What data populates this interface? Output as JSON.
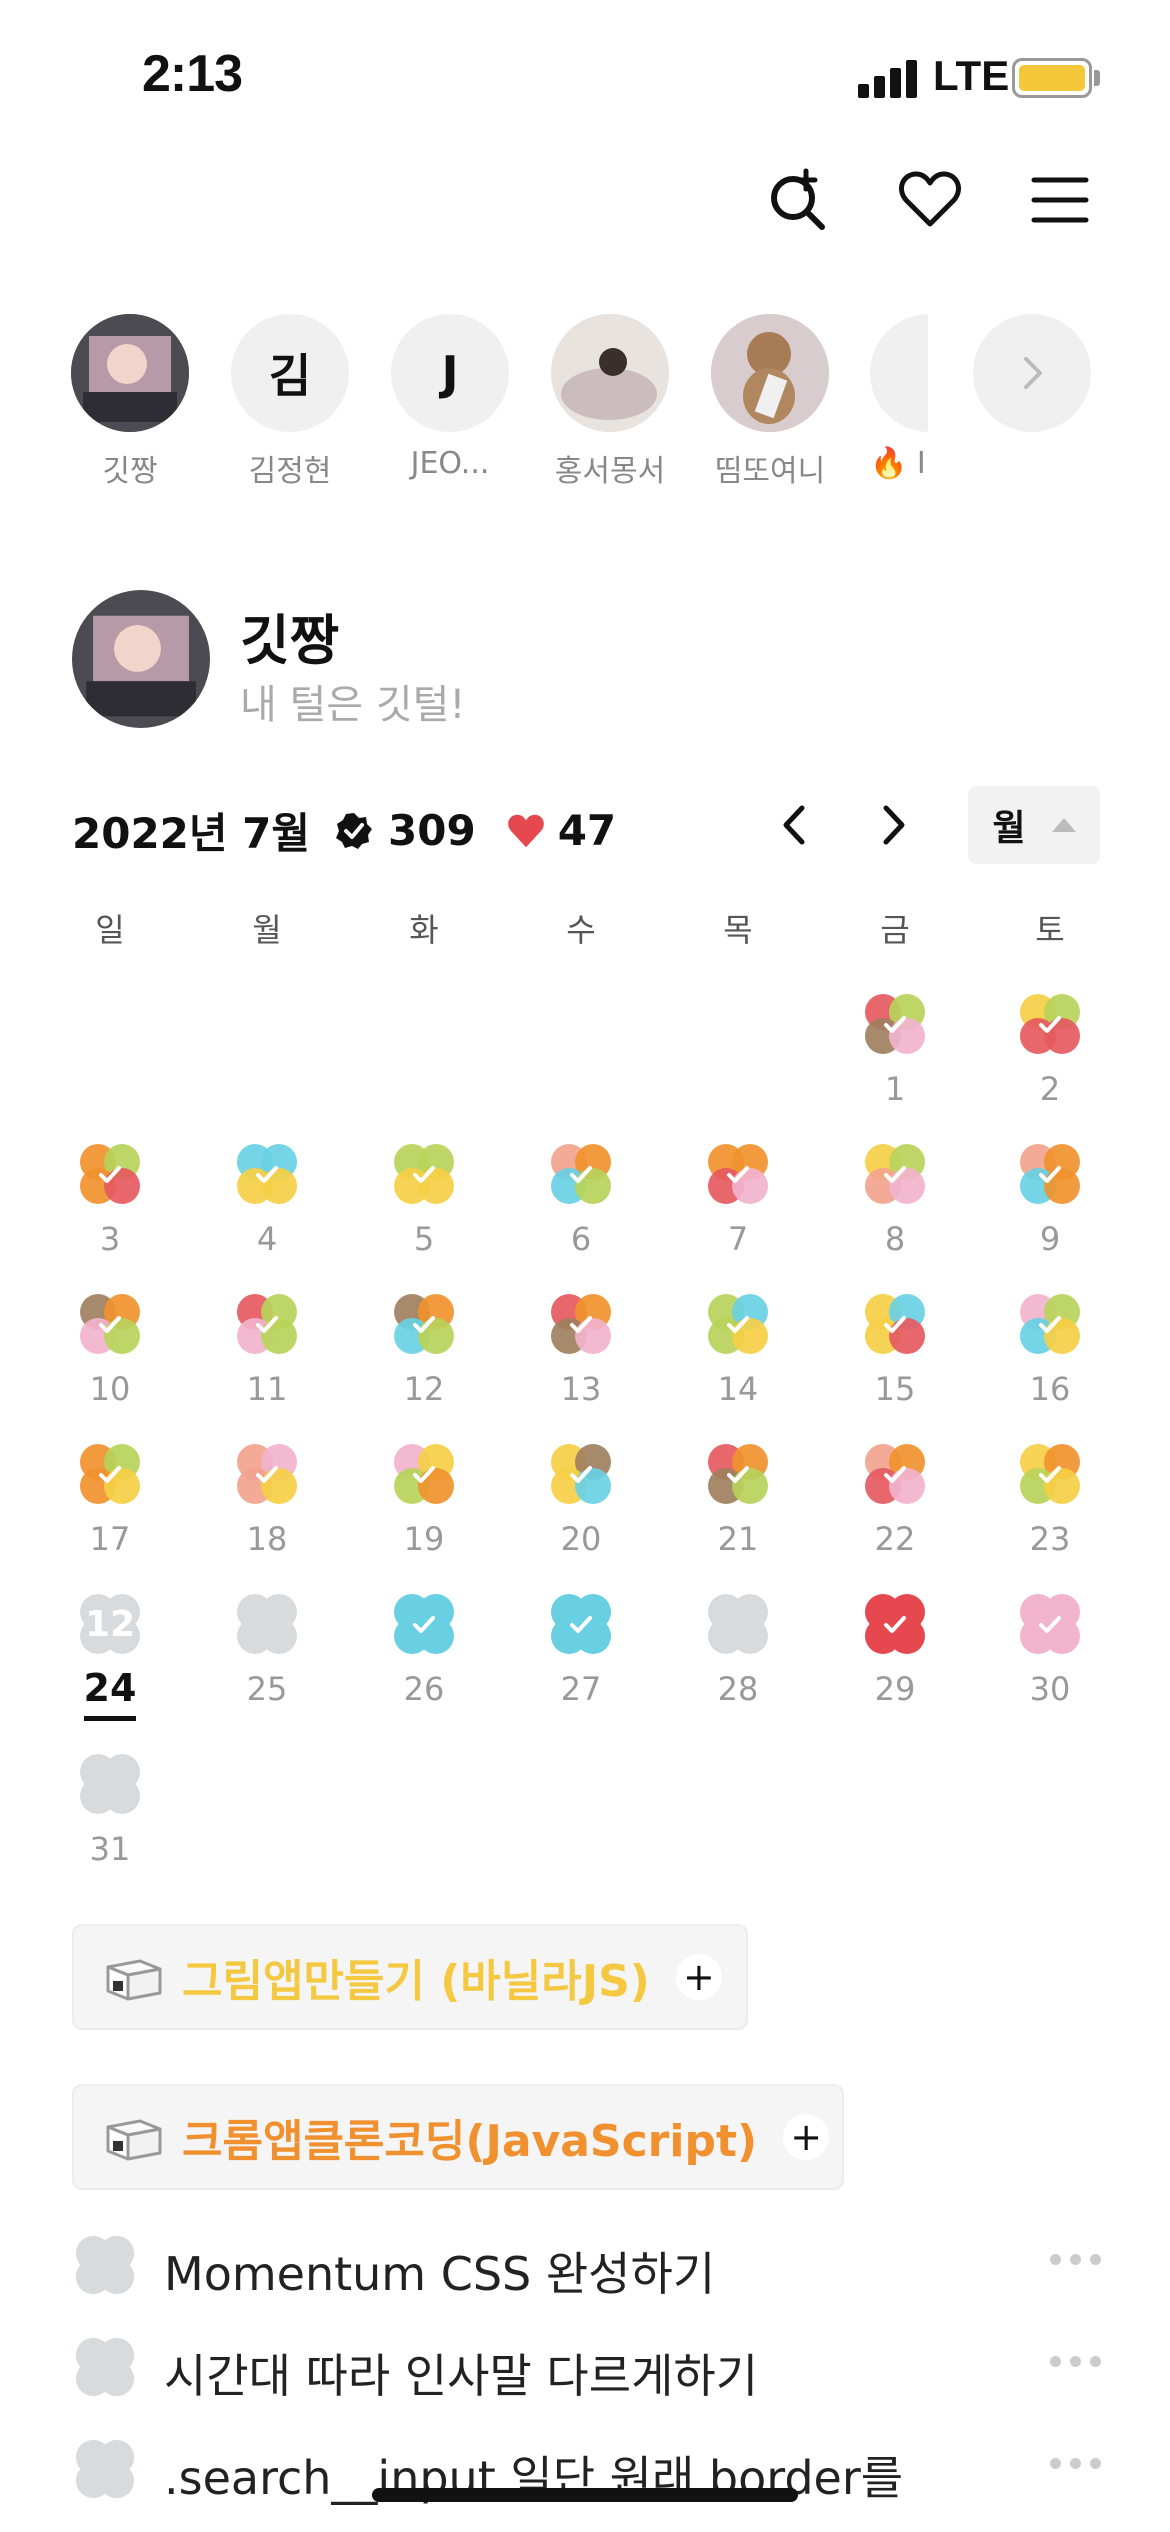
{
  "status_bar": {
    "time": "2:13",
    "network": "LTE"
  },
  "top_icons": [
    "search-plus-icon",
    "heart-icon",
    "menu-icon"
  ],
  "friends": [
    {
      "initial": "",
      "name": "깃짱",
      "photo": true
    },
    {
      "initial": "김",
      "name": "김정현",
      "photo": false
    },
    {
      "initial": "J",
      "name": "JEO...",
      "photo": false
    },
    {
      "initial": "",
      "name": "홍서몽서",
      "photo": true
    },
    {
      "initial": "",
      "name": "띰또여니",
      "photo": true
    },
    {
      "initial": "🔥",
      "name": "🔥 I",
      "photo": false
    }
  ],
  "profile": {
    "name": "깃짱",
    "bio": "내 털은 깃털!"
  },
  "calendar": {
    "month_label": "2022년 7월",
    "check_count": "309",
    "heart_count": "47",
    "view_toggle": "월",
    "weekdays": [
      "일",
      "월",
      "화",
      "수",
      "목",
      "금",
      "토"
    ],
    "today": 24,
    "today_pending_count": "12"
  },
  "goals": [
    {
      "title": "그림앱만들기 (바닐라JS)",
      "color": "#f5c842"
    },
    {
      "title": "크롬앱클론코딩(JavaScript)",
      "color": "#f0902e"
    }
  ],
  "todos": [
    "Momentum CSS 완성하기",
    "시간대 따라 인사말 다르게하기",
    ".search__input 일단 원래 border를"
  ],
  "colors": {
    "red": "#e55a5f",
    "green": "#b9d35a",
    "brown": "#a08060",
    "pink": "#f2b3cd",
    "yellow": "#f5cf45",
    "orange": "#f0922e",
    "cyan": "#69d0e3",
    "salmon": "#f2a38e",
    "gray": "#d8dbde",
    "bright_red": "#e5484f"
  }
}
